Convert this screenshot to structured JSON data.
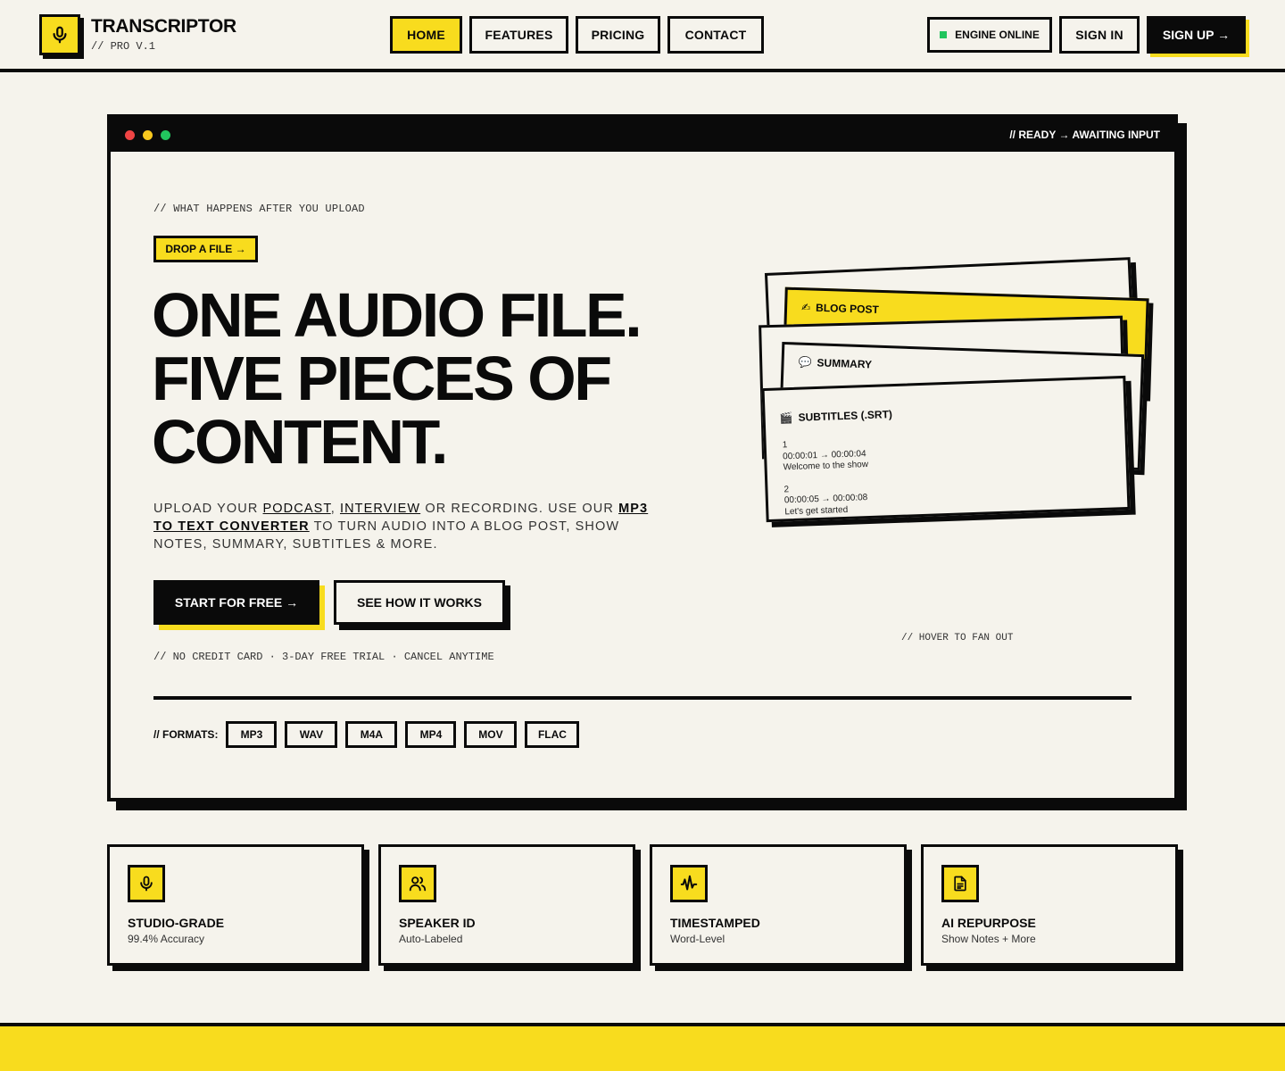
{
  "brand": {
    "name": "TRANSCRIPTOR",
    "sub": "// PRO V.1"
  },
  "nav": {
    "items": [
      {
        "label": "HOME",
        "active": true
      },
      {
        "label": "FEATURES"
      },
      {
        "label": "PRICING"
      },
      {
        "label": "CONTACT"
      }
    ],
    "status": "ENGINE ONLINE",
    "sign_in": "SIGN IN",
    "sign_up": "SIGN UP →"
  },
  "window": {
    "status": "// READY → AWAITING INPUT"
  },
  "hero": {
    "eyebrow": "// WHAT HAPPENS AFTER YOU UPLOAD",
    "drop_button": "DROP A FILE →",
    "headline": [
      "ONE AUDIO FILE.",
      "FIVE PIECES OF",
      "CONTENT."
    ],
    "lede": {
      "t1": "UPLOAD YOUR ",
      "link_podcast": "PODCAST",
      "t2": ", ",
      "link_interview": "INTERVIEW",
      "t3": " OR RECORDING. USE OUR ",
      "link_converter": "MP3 TO TEXT CONVERTER",
      "t4": " TO TURN AUDIO INTO A BLOG POST, SHOW NOTES, SUMMARY, SUBTITLES & MORE."
    },
    "cta_primary": "START FOR FREE →",
    "cta_secondary": "SEE HOW IT WORKS",
    "fine_print": "// NO CREDIT CARD · 3-DAY FREE TRIAL · CANCEL ANYTIME",
    "formats_label": "// FORMATS:",
    "formats": [
      "MP3",
      "WAV",
      "M4A",
      "MP4",
      "MOV",
      "FLAC"
    ],
    "hover_hint": "// HOVER TO FAN OUT"
  },
  "cards": {
    "blog": {
      "icon": "✍",
      "title": "BLOG POST"
    },
    "summary": {
      "icon": "💬",
      "title": "SUMMARY"
    },
    "subtitles": {
      "icon": "🎬",
      "title": "SUBTITLES (.SRT)",
      "lines": [
        "1",
        "00:00:01 → 00:00:04",
        "Welcome to the show",
        "",
        "2",
        "00:00:05 → 00:00:08",
        "Let's get started"
      ]
    }
  },
  "features": [
    {
      "icon": "microphone-icon",
      "title": "STUDIO-GRADE",
      "sub": "99.4% Accuracy"
    },
    {
      "icon": "users-icon",
      "title": "SPEAKER ID",
      "sub": "Auto-Labeled"
    },
    {
      "icon": "waveform-icon",
      "title": "TIMESTAMPED",
      "sub": "Word-Level"
    },
    {
      "icon": "document-icon",
      "title": "AI REPURPOSE",
      "sub": "Show Notes + More"
    }
  ],
  "colors": {
    "accent": "#f8dc1e",
    "ink": "#0a0a0a",
    "paper": "#f5f3ec",
    "online": "#22c55e"
  }
}
